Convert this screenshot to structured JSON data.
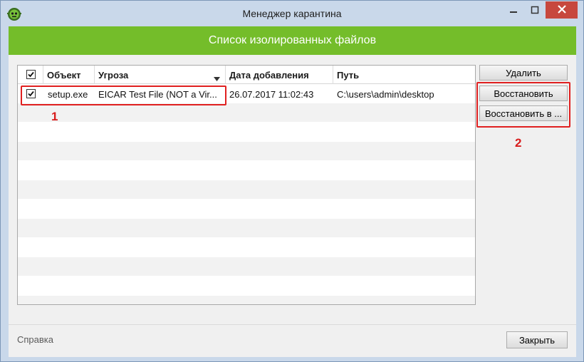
{
  "window": {
    "title": "Менеджер карантина"
  },
  "header": {
    "title": "Список изолированных файлов"
  },
  "table": {
    "columns": {
      "object": "Объект",
      "threat": "Угроза",
      "date": "Дата добавления",
      "path": "Путь"
    },
    "rows": [
      {
        "checked": true,
        "object": "setup.exe",
        "threat": "EICAR Test File (NOT a Vir...",
        "date": "26.07.2017 11:02:43",
        "path": "C:\\users\\admin\\desktop"
      }
    ]
  },
  "actions": {
    "delete": "Удалить",
    "restore": "Восстановить",
    "restore_to": "Восстановить в ..."
  },
  "annotations": {
    "marker_1": "1",
    "marker_2": "2"
  },
  "footer": {
    "help": "Справка",
    "close": "Закрыть"
  },
  "colors": {
    "header_green": "#74bd2a",
    "annotation_red": "#e02020",
    "close_button": "#c7483e"
  },
  "icons": {
    "app": "shield-bug-icon",
    "minimize": "minimize-icon",
    "maximize": "maximize-icon",
    "close": "close-icon",
    "sort": "sort-down-icon",
    "check": "checkmark-icon"
  }
}
